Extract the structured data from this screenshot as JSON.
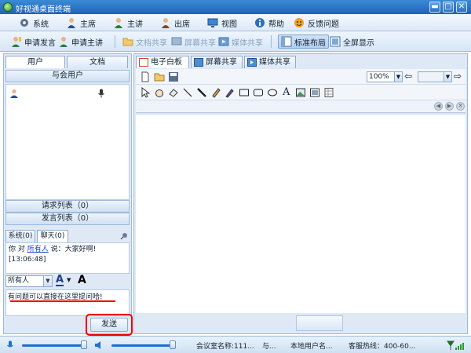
{
  "window": {
    "title": "好视通桌面终端",
    "controls": {
      "minimize": "▬",
      "maximize": "□",
      "close": "✕"
    }
  },
  "menu": [
    {
      "label": "系统",
      "icon": "gear-icon"
    },
    {
      "label": "主席",
      "icon": "chairman-icon"
    },
    {
      "label": "主讲",
      "icon": "speaker-icon"
    },
    {
      "label": "出席",
      "icon": "attendee-icon"
    },
    {
      "label": "视图",
      "icon": "monitor-icon"
    },
    {
      "label": "帮助",
      "icon": "info-icon"
    },
    {
      "label": "反馈问题",
      "icon": "feedback-icon"
    }
  ],
  "toolbar": {
    "request_speak": "申请发言",
    "request_host": "申请主讲",
    "doc_share": "文档共享",
    "screen_share": "屏幕共享",
    "media_share": "媒体共享",
    "standard_layout": "标准布局",
    "fullscreen": "全屏显示"
  },
  "left": {
    "tabs": [
      "用户",
      "文档"
    ],
    "attendees_header": "与会用户",
    "request_list": "请求列表（0）",
    "speak_list": "发言列表（0）",
    "chat_tabs": [
      "系统(0)",
      "聊天(0)"
    ],
    "chat": {
      "you": "你 对",
      "everyone": "所有人",
      "said": "说：大家好啊!",
      "time": "[13:06:48]"
    },
    "recipient": "所有人",
    "font_a": "A",
    "input_text": "有问题可以直接在这里提问哈!",
    "send": "发送"
  },
  "right": {
    "tabs": [
      "电子白板",
      "屏幕共享",
      "媒体共享"
    ],
    "zoom": "100%"
  },
  "status": {
    "room_name": "会议室名称:111...",
    "with": "与...",
    "local_user": "本地用户名...",
    "hotline": "客服热线：400-60..."
  },
  "colors": {
    "accent": "#1e63b8",
    "highlight": "#e00000"
  }
}
